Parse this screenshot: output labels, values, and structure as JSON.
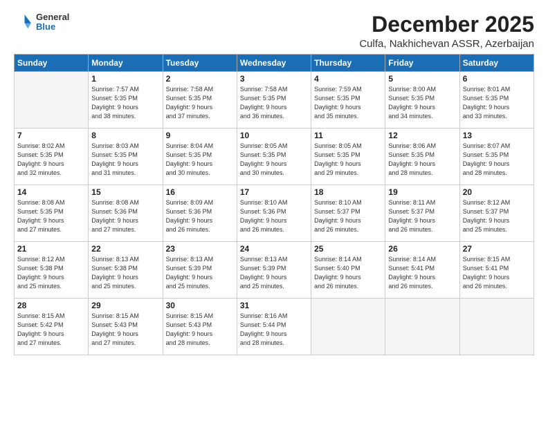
{
  "logo": {
    "general": "General",
    "blue": "Blue"
  },
  "header": {
    "month": "December 2025",
    "location": "Culfa, Nakhichevan ASSR, Azerbaijan"
  },
  "weekdays": [
    "Sunday",
    "Monday",
    "Tuesday",
    "Wednesday",
    "Thursday",
    "Friday",
    "Saturday"
  ],
  "weeks": [
    [
      {
        "day": "",
        "info": ""
      },
      {
        "day": "1",
        "info": "Sunrise: 7:57 AM\nSunset: 5:35 PM\nDaylight: 9 hours\nand 38 minutes."
      },
      {
        "day": "2",
        "info": "Sunrise: 7:58 AM\nSunset: 5:35 PM\nDaylight: 9 hours\nand 37 minutes."
      },
      {
        "day": "3",
        "info": "Sunrise: 7:58 AM\nSunset: 5:35 PM\nDaylight: 9 hours\nand 36 minutes."
      },
      {
        "day": "4",
        "info": "Sunrise: 7:59 AM\nSunset: 5:35 PM\nDaylight: 9 hours\nand 35 minutes."
      },
      {
        "day": "5",
        "info": "Sunrise: 8:00 AM\nSunset: 5:35 PM\nDaylight: 9 hours\nand 34 minutes."
      },
      {
        "day": "6",
        "info": "Sunrise: 8:01 AM\nSunset: 5:35 PM\nDaylight: 9 hours\nand 33 minutes."
      }
    ],
    [
      {
        "day": "7",
        "info": "Sunrise: 8:02 AM\nSunset: 5:35 PM\nDaylight: 9 hours\nand 32 minutes."
      },
      {
        "day": "8",
        "info": "Sunrise: 8:03 AM\nSunset: 5:35 PM\nDaylight: 9 hours\nand 31 minutes."
      },
      {
        "day": "9",
        "info": "Sunrise: 8:04 AM\nSunset: 5:35 PM\nDaylight: 9 hours\nand 30 minutes."
      },
      {
        "day": "10",
        "info": "Sunrise: 8:05 AM\nSunset: 5:35 PM\nDaylight: 9 hours\nand 30 minutes."
      },
      {
        "day": "11",
        "info": "Sunrise: 8:05 AM\nSunset: 5:35 PM\nDaylight: 9 hours\nand 29 minutes."
      },
      {
        "day": "12",
        "info": "Sunrise: 8:06 AM\nSunset: 5:35 PM\nDaylight: 9 hours\nand 28 minutes."
      },
      {
        "day": "13",
        "info": "Sunrise: 8:07 AM\nSunset: 5:35 PM\nDaylight: 9 hours\nand 28 minutes."
      }
    ],
    [
      {
        "day": "14",
        "info": "Sunrise: 8:08 AM\nSunset: 5:35 PM\nDaylight: 9 hours\nand 27 minutes."
      },
      {
        "day": "15",
        "info": "Sunrise: 8:08 AM\nSunset: 5:36 PM\nDaylight: 9 hours\nand 27 minutes."
      },
      {
        "day": "16",
        "info": "Sunrise: 8:09 AM\nSunset: 5:36 PM\nDaylight: 9 hours\nand 26 minutes."
      },
      {
        "day": "17",
        "info": "Sunrise: 8:10 AM\nSunset: 5:36 PM\nDaylight: 9 hours\nand 26 minutes."
      },
      {
        "day": "18",
        "info": "Sunrise: 8:10 AM\nSunset: 5:37 PM\nDaylight: 9 hours\nand 26 minutes."
      },
      {
        "day": "19",
        "info": "Sunrise: 8:11 AM\nSunset: 5:37 PM\nDaylight: 9 hours\nand 26 minutes."
      },
      {
        "day": "20",
        "info": "Sunrise: 8:12 AM\nSunset: 5:37 PM\nDaylight: 9 hours\nand 25 minutes."
      }
    ],
    [
      {
        "day": "21",
        "info": "Sunrise: 8:12 AM\nSunset: 5:38 PM\nDaylight: 9 hours\nand 25 minutes."
      },
      {
        "day": "22",
        "info": "Sunrise: 8:13 AM\nSunset: 5:38 PM\nDaylight: 9 hours\nand 25 minutes."
      },
      {
        "day": "23",
        "info": "Sunrise: 8:13 AM\nSunset: 5:39 PM\nDaylight: 9 hours\nand 25 minutes."
      },
      {
        "day": "24",
        "info": "Sunrise: 8:13 AM\nSunset: 5:39 PM\nDaylight: 9 hours\nand 25 minutes."
      },
      {
        "day": "25",
        "info": "Sunrise: 8:14 AM\nSunset: 5:40 PM\nDaylight: 9 hours\nand 26 minutes."
      },
      {
        "day": "26",
        "info": "Sunrise: 8:14 AM\nSunset: 5:41 PM\nDaylight: 9 hours\nand 26 minutes."
      },
      {
        "day": "27",
        "info": "Sunrise: 8:15 AM\nSunset: 5:41 PM\nDaylight: 9 hours\nand 26 minutes."
      }
    ],
    [
      {
        "day": "28",
        "info": "Sunrise: 8:15 AM\nSunset: 5:42 PM\nDaylight: 9 hours\nand 27 minutes."
      },
      {
        "day": "29",
        "info": "Sunrise: 8:15 AM\nSunset: 5:43 PM\nDaylight: 9 hours\nand 27 minutes."
      },
      {
        "day": "30",
        "info": "Sunrise: 8:15 AM\nSunset: 5:43 PM\nDaylight: 9 hours\nand 28 minutes."
      },
      {
        "day": "31",
        "info": "Sunrise: 8:16 AM\nSunset: 5:44 PM\nDaylight: 9 hours\nand 28 minutes."
      },
      {
        "day": "",
        "info": ""
      },
      {
        "day": "",
        "info": ""
      },
      {
        "day": "",
        "info": ""
      }
    ]
  ]
}
